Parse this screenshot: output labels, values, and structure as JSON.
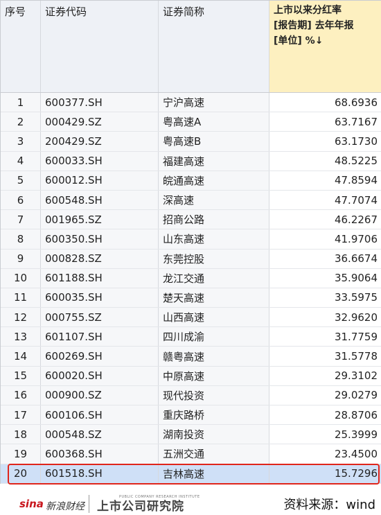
{
  "table": {
    "headers": {
      "seq": "序号",
      "code": "证券代码",
      "name": "证券简称",
      "metric_line1": "上市以来分红率",
      "metric_line2": "[报告期] 去年年报",
      "metric_line3": "[单位] %↓"
    },
    "rows": [
      {
        "seq": "1",
        "code": "600377.SH",
        "name": "宁沪高速",
        "value": "68.6936"
      },
      {
        "seq": "2",
        "code": "000429.SZ",
        "name": "粤高速A",
        "value": "63.7167"
      },
      {
        "seq": "3",
        "code": "200429.SZ",
        "name": "粤高速B",
        "value": "63.1730"
      },
      {
        "seq": "4",
        "code": "600033.SH",
        "name": "福建高速",
        "value": "48.5225"
      },
      {
        "seq": "5",
        "code": "600012.SH",
        "name": "皖通高速",
        "value": "47.8594"
      },
      {
        "seq": "6",
        "code": "600548.SH",
        "name": "深高速",
        "value": "47.7074"
      },
      {
        "seq": "7",
        "code": "001965.SZ",
        "name": "招商公路",
        "value": "46.2267"
      },
      {
        "seq": "8",
        "code": "600350.SH",
        "name": "山东高速",
        "value": "41.9706"
      },
      {
        "seq": "9",
        "code": "000828.SZ",
        "name": "东莞控股",
        "value": "36.6674"
      },
      {
        "seq": "10",
        "code": "601188.SH",
        "name": "龙江交通",
        "value": "35.9064"
      },
      {
        "seq": "11",
        "code": "600035.SH",
        "name": "楚天高速",
        "value": "33.5975"
      },
      {
        "seq": "12",
        "code": "000755.SZ",
        "name": "山西高速",
        "value": "32.9620"
      },
      {
        "seq": "13",
        "code": "601107.SH",
        "name": "四川成渝",
        "value": "31.7759"
      },
      {
        "seq": "14",
        "code": "600269.SH",
        "name": "赣粤高速",
        "value": "31.5778"
      },
      {
        "seq": "15",
        "code": "600020.SH",
        "name": "中原高速",
        "value": "29.3102"
      },
      {
        "seq": "16",
        "code": "000900.SZ",
        "name": "现代投资",
        "value": "29.0279"
      },
      {
        "seq": "17",
        "code": "600106.SH",
        "name": "重庆路桥",
        "value": "28.8706"
      },
      {
        "seq": "18",
        "code": "000548.SZ",
        "name": "湖南投资",
        "value": "25.3999"
      },
      {
        "seq": "19",
        "code": "600368.SH",
        "name": "五洲交通",
        "value": "23.4500"
      },
      {
        "seq": "20",
        "code": "601518.SH",
        "name": "吉林高速",
        "value": "15.7296"
      }
    ],
    "selected_row": "20"
  },
  "footer": {
    "sina_logo": "sina",
    "sina_name": "新浪财经",
    "institute_logo": "上市公司研究院",
    "institute_sub": "PUBLIC COMPANY RESEARCH INSTITUTE",
    "source": "资料来源：wind"
  },
  "colors": {
    "header_bg": "#eef1f6",
    "metric_header_bg": "#fdf0c0",
    "selected_row_bg": "#cfe0f7",
    "highlight_border": "#e0251b"
  }
}
